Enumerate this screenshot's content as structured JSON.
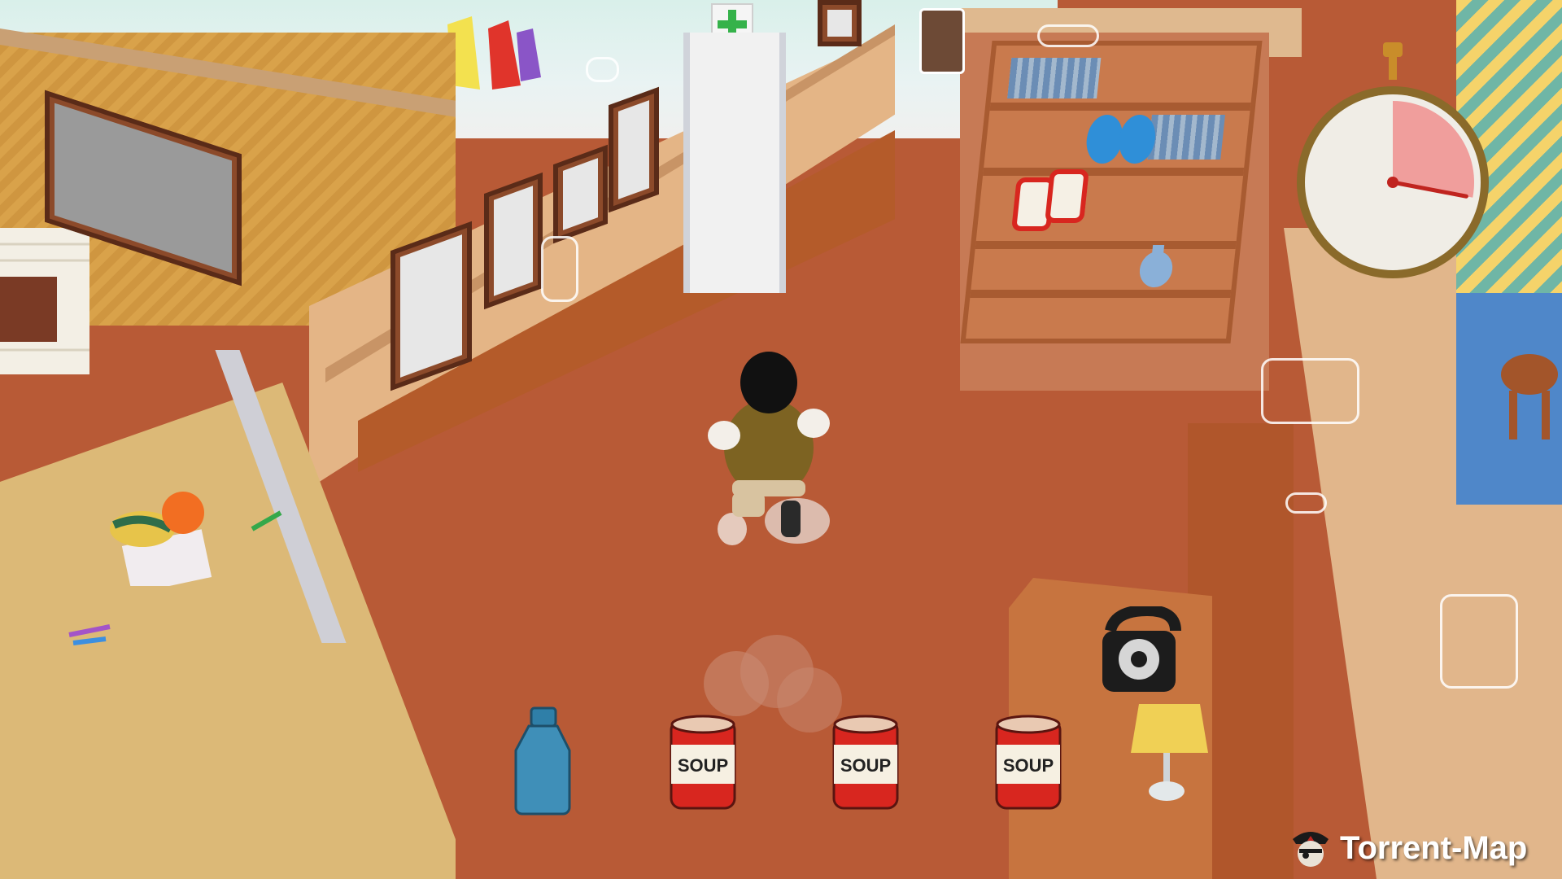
{
  "scene": {
    "can_label": "SOUP"
  },
  "inventory": {
    "items": [
      {
        "icon": "water-bottle-icon",
        "label": ""
      },
      {
        "icon": "soup-can-icon",
        "label": "SOUP"
      },
      {
        "icon": "soup-can-icon",
        "label": "SOUP"
      },
      {
        "icon": "soup-can-icon",
        "label": "SOUP"
      }
    ]
  },
  "timer": {
    "elapsed_fraction": 0.28
  },
  "watermark": {
    "text": "Torrent-Map"
  },
  "colors": {
    "carpet": "#b85a36",
    "wall": "#e4b586",
    "wainscot": "#b45b2a",
    "soup_red": "#d8261f",
    "bottle_blue": "#3f8fb8"
  }
}
